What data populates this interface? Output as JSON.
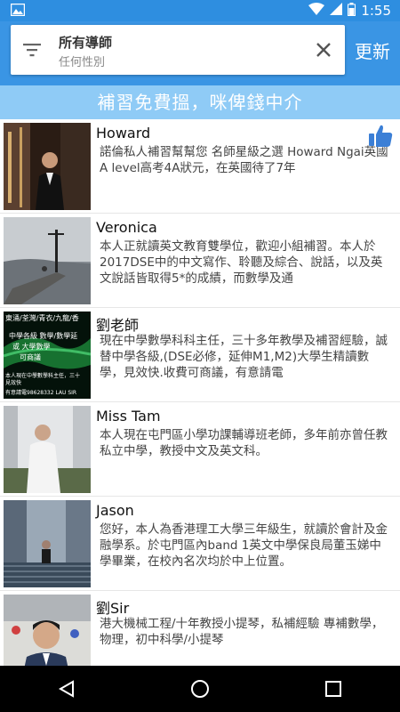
{
  "status": {
    "time": "1:55"
  },
  "search": {
    "title": "所有導師",
    "subtitle": "任何性別"
  },
  "toolbar": {
    "refresh_label": "更新"
  },
  "banner": {
    "text": "補習免費搵，咪俾錢中介"
  },
  "tutors": [
    {
      "name": "Howard",
      "desc": "諾倫私人補習幫幫您 名師星級之選 Howard Ngai英國A level高考4A狀元，在英國待了7年"
    },
    {
      "name": "Veronica",
      "desc": "本人正就讀英文教育雙學位，歡迎小組補習。本人於2017DSE中的中文寫作、聆聽及綜合、說話，以及英文說話皆取得5*的成績，而數學及通"
    },
    {
      "name": "劉老師",
      "desc": "現在中學數學科科主任，三十多年教學及補習經驗，誠替中學各級,(DSE必修，延伸M1,M2)大學生精讀數學，見效快.收費可商議，有意請電"
    },
    {
      "name": "Miss Tam",
      "desc": "本人現在屯門區小學功課輔導班老師，多年前亦曾任教私立中學，教授中文及英文科。"
    },
    {
      "name": "Jason",
      "desc": "您好，本人為香港理工大學三年級生，就讀於會計及金融學系。於屯門區內band 1英文中學保良局董玉娣中學畢業，在校內名次均於中上位置。"
    },
    {
      "name": "劉Sir",
      "desc": "港大機械工程/十年教授小提琴，私補經驗 專補數學，物理，初中科學/小提琴"
    }
  ],
  "thumb3": {
    "line1": "東涌/荃灣/青衣/九龍/香",
    "line2": "中學各級 數學/數學延",
    "line3": "或 大學數學",
    "line4": "可商議",
    "line5": "本人現在中學數學科主任，三十",
    "line6": "見效快",
    "line7": "有意請電98628332 LAU SIR"
  },
  "colors": {
    "appbar": "#3a95e4",
    "banner": "#8fcbf6",
    "like": "#3b7fd6"
  }
}
